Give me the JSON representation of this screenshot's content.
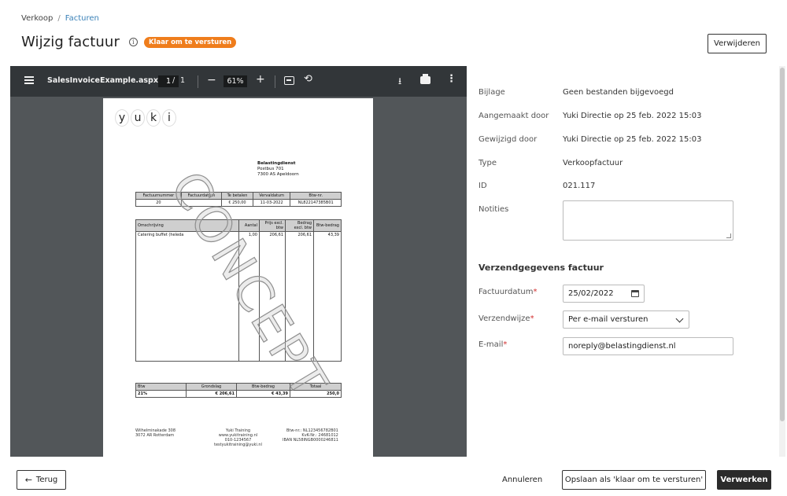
{
  "breadcrumb": {
    "parent": "Verkoop",
    "separator": "/",
    "current": "Facturen"
  },
  "page": {
    "title": "Wijzig factuur",
    "info_icon": "info-icon",
    "status_badge": "Klaar om te versturen",
    "delete_label": "Verwijderen"
  },
  "viewer": {
    "file_name": "SalesInvoiceExample.aspx",
    "page_current": "1",
    "page_separator": "/",
    "page_total": "1",
    "zoom": "61%",
    "zoom_out": "−",
    "zoom_in": "+"
  },
  "invoice": {
    "logo_letters": [
      "y",
      "u",
      "k",
      "i"
    ],
    "recipient": {
      "name": "Belastingdienst",
      "street": "Postbus 701",
      "city": "7300 AS  Apeldoorn"
    },
    "header_table": {
      "columns": [
        "Factuurnummer",
        "Factuurdatum",
        "Te betalen",
        "Vervaldatum",
        "Btw-nr."
      ],
      "row": [
        "20",
        "",
        "€ 250,00",
        "11-03-2022",
        "NL822147385B01"
      ]
    },
    "lines_table": {
      "columns": [
        "Omschrijving",
        "Aantal",
        "Prijs excl. btw",
        "Bedrag excl. btw",
        "Btw-bedrag"
      ],
      "row": [
        "Catering buffet (heleda",
        "1,00",
        "206,61",
        "206,61",
        "43,39"
      ]
    },
    "vat_table": {
      "columns": [
        "Btw",
        "Grondslag",
        "Btw-bedrag",
        "Totaal"
      ],
      "row": [
        "21%",
        "€ 206,61",
        "€ 43,39",
        "250,0"
      ]
    },
    "footer": {
      "left": [
        "Wilhelminakade 308",
        "3072 AR Rotterdam"
      ],
      "center": [
        "Yuki Training",
        "www.yukitraining.nl",
        "010-1234567",
        "testyukitraining@yuki.nl"
      ],
      "right": [
        "Btw-nr.: NL123456782B01",
        "KvK-Nr.: 24681012",
        "IBAN NL58INGB0000246811"
      ]
    },
    "watermark": "CONCEPT"
  },
  "details": [
    {
      "label": "Bijlage",
      "value": "Geen bestanden bijgevoegd"
    },
    {
      "label": "Aangemaakt door",
      "value": "Yuki Directie op 25 feb. 2022 15:03"
    },
    {
      "label": "Gewijzigd door",
      "value": "Yuki Directie op 25 feb. 2022 15:03"
    },
    {
      "label": "Type",
      "value": "Verkoopfactuur"
    },
    {
      "label": "ID",
      "value": "021.117"
    },
    {
      "label": "Notities",
      "value": ""
    }
  ],
  "shipping": {
    "title": "Verzendgegevens factuur",
    "invoice_date_label": "Factuurdatum",
    "invoice_date_value": "25/02/2022",
    "method_label": "Verzendwijze",
    "method_value": "Per e-mail versturen",
    "email_label": "E-mail",
    "email_value": "noreply@belastingdienst.nl",
    "required_mark": "*"
  },
  "footer_actions": {
    "back_label": "Terug",
    "cancel_label": "Annuleren",
    "save_ready_label": "Opslaan als 'klaar om te versturen'",
    "process_label": "Verwerken"
  },
  "colors": {
    "badge": "#ef7d1c",
    "link": "#3b82b8",
    "primary_button": "#2b2b2b",
    "viewer_toolbar": "#323639",
    "required": "#d32f2f"
  }
}
